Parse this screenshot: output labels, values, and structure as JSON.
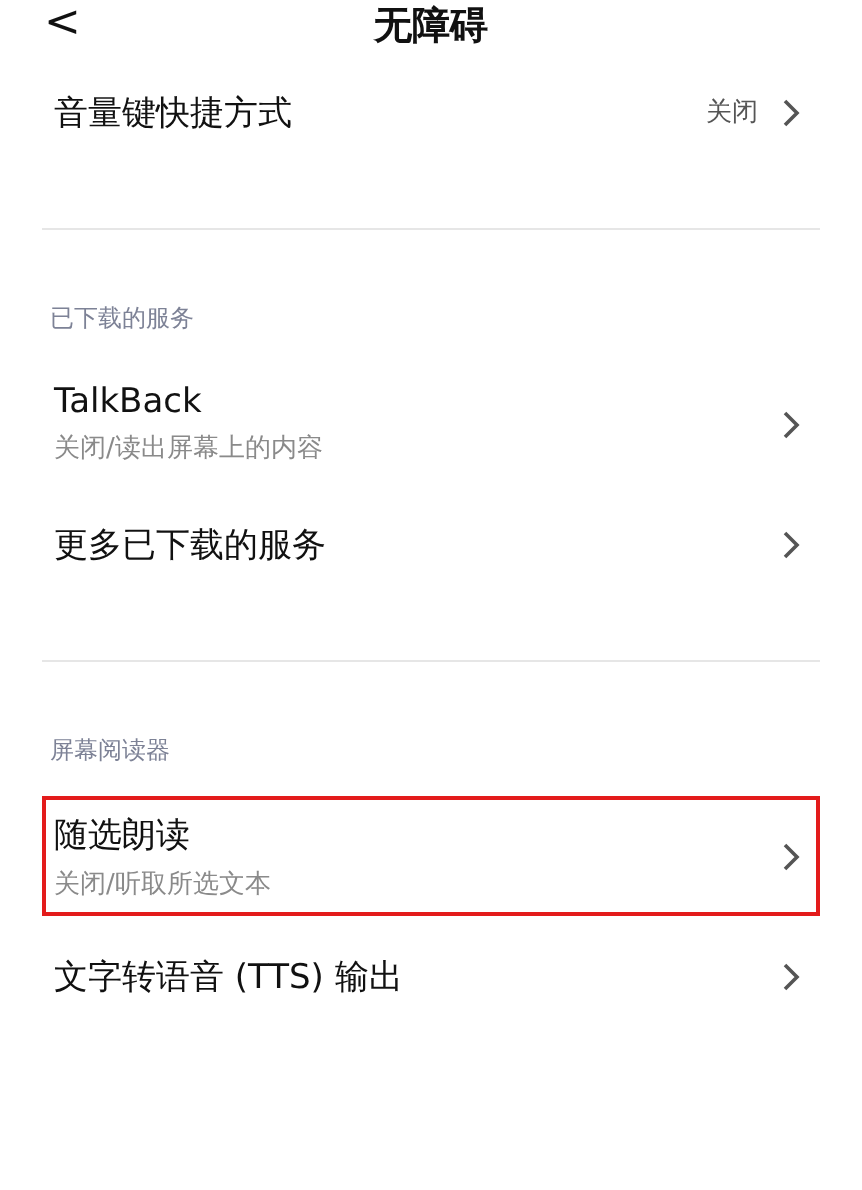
{
  "header": {
    "back": "<",
    "title": "无障碍"
  },
  "sections": [
    {
      "items": [
        {
          "title": "音量键快捷方式",
          "value": "关闭",
          "highlighted": false
        }
      ]
    },
    {
      "heading": "已下载的服务",
      "items": [
        {
          "title": "TalkBack",
          "subtitle": "关闭/读出屏幕上的内容",
          "highlighted": false
        },
        {
          "title": "更多已下载的服务",
          "highlighted": false
        }
      ]
    },
    {
      "heading": "屏幕阅读器",
      "items": [
        {
          "title": "随选朗读",
          "subtitle": "关闭/听取所选文本",
          "highlighted": true
        },
        {
          "title": "文字转语音 (TTS) 输出",
          "highlighted": false
        }
      ]
    }
  ]
}
